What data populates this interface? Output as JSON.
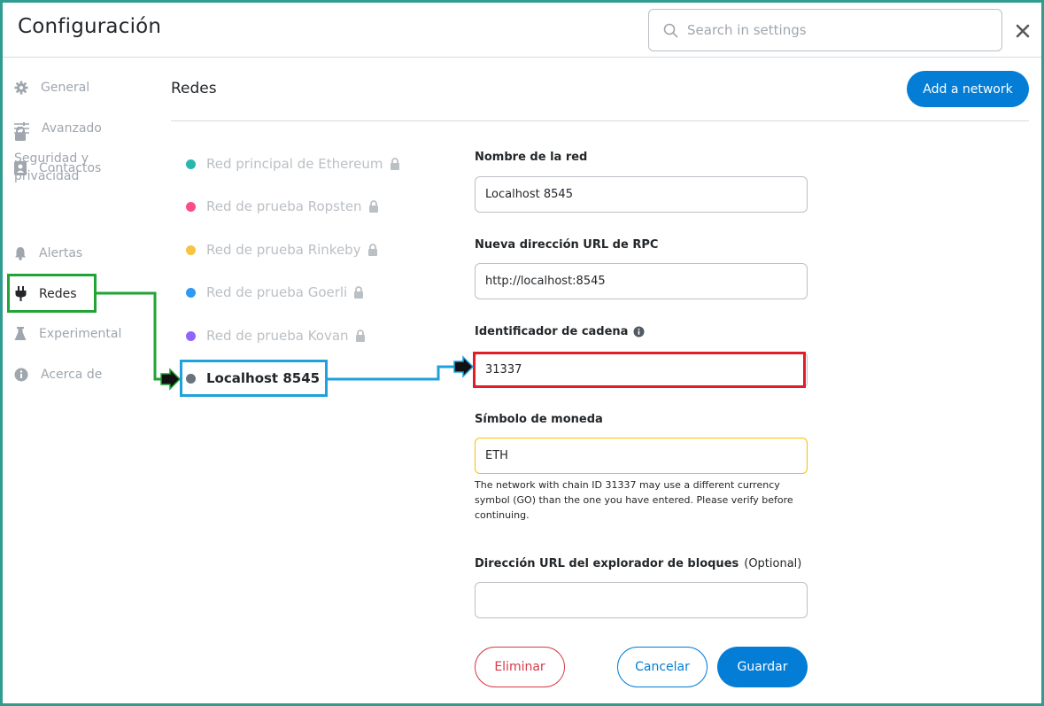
{
  "header": {
    "title": "Configuración",
    "search_placeholder": "Search in settings"
  },
  "sidebar": {
    "items": [
      {
        "label": "General",
        "icon": "gear-icon"
      },
      {
        "label": "Avanzado",
        "icon": "sliders-icon"
      },
      {
        "label": "Contactos",
        "icon": "contacts-icon"
      },
      {
        "label": "Seguridad y privacidad",
        "icon": "lock-icon"
      },
      {
        "label": "Alertas",
        "icon": "bell-icon"
      },
      {
        "label": "Redes",
        "icon": "plug-icon",
        "active": true
      },
      {
        "label": "Experimental",
        "icon": "flask-icon"
      },
      {
        "label": "Acerca de",
        "icon": "info-icon"
      }
    ]
  },
  "main": {
    "title": "Redes",
    "add_network_label": "Add a network",
    "networks": [
      {
        "label": "Red principal de Ethereum",
        "color": "#29b6af",
        "locked": true
      },
      {
        "label": "Red de prueba Ropsten",
        "color": "#ff4a8d",
        "locked": true
      },
      {
        "label": "Red de prueba Rinkeby",
        "color": "#f6c343",
        "locked": true
      },
      {
        "label": "Red de prueba Goerli",
        "color": "#3099f2",
        "locked": true
      },
      {
        "label": "Red de prueba Kovan",
        "color": "#9064ff",
        "locked": true
      },
      {
        "label": "Localhost 8545",
        "color": "#6a737d",
        "locked": false,
        "active": true
      }
    ],
    "form": {
      "network_name_label": "Nombre de la red",
      "network_name_value": "Localhost 8545",
      "rpc_url_label": "Nueva dirección URL de RPC",
      "rpc_url_value": "http://localhost:8545",
      "chain_id_label": "Identificador de cadena",
      "chain_id_value": "31337",
      "currency_symbol_label": "Símbolo de moneda",
      "currency_symbol_value": "ETH",
      "currency_warning": "The network with chain ID 31337 may use a different currency symbol (GO) than the one you have entered. Please verify before continuing.",
      "explorer_url_label": "Dirección URL del explorador de bloques",
      "explorer_url_optional": "(Optional)",
      "explorer_url_value": ""
    },
    "buttons": {
      "delete": "Eliminar",
      "cancel": "Cancelar",
      "save": "Guardar"
    }
  },
  "colors": {
    "primary": "#037dd6",
    "frame": "#2f9c8f",
    "highlight_green": "#21a336",
    "highlight_blue": "#1ea1dc",
    "highlight_red": "#e21d2a",
    "warning_border": "#f8c000",
    "danger": "#d73a49"
  }
}
